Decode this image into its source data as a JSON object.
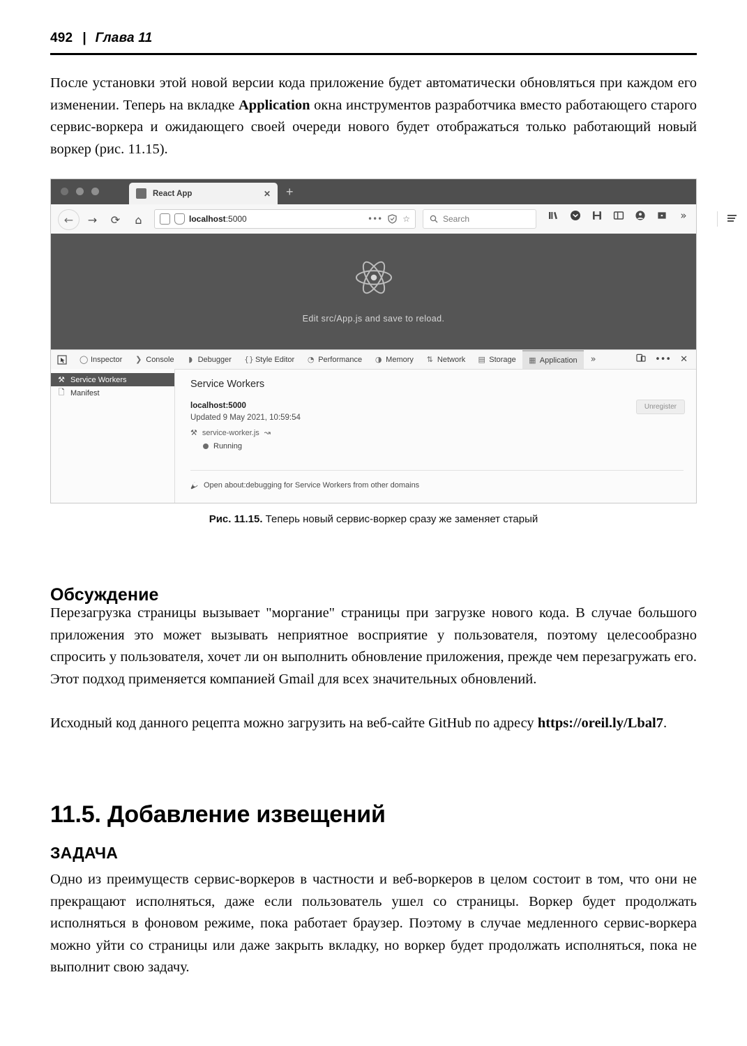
{
  "running_head": {
    "folio": "492",
    "separator": "|",
    "chapter": "Глава 11"
  },
  "intro_paragraph": {
    "before_bold": "После установки этой новой версии кода приложение будет автоматически обновляться при каждом его изменении. Теперь на вкладке ",
    "bold": "Application",
    "after_bold": " окна инструментов разработчика вместо работающего старого сервис-воркера и ожидающего своей очереди нового будет отображаться только работающий новый воркер (рис. 11.15)."
  },
  "figure": {
    "browser": {
      "tab_title": "React App",
      "tab_close": "✕",
      "new_tab": "+",
      "nav": {
        "back": "←",
        "forward": "→",
        "reload": "⟳",
        "home": "⌂"
      },
      "url": {
        "host": "localhost",
        "port": ":5000",
        "overflow": "•••",
        "shield": "shield-icon",
        "bookmark": "☆"
      },
      "search_placeholder": "Search",
      "toolbar_icons": [
        "library-icon",
        "pocket-icon",
        "save-to-pocket-icon",
        "sidebar-icon",
        "account-icon",
        "extension-icon",
        "overflow-icon"
      ],
      "overflow": "»",
      "menu": "hamburger-menu-icon"
    },
    "react_page": {
      "caption": "Edit src/App.js and save to reload."
    },
    "devtools": {
      "tabs": [
        {
          "label": "Inspector",
          "glyph": "◯",
          "selected": false
        },
        {
          "label": "Console",
          "glyph": "❯",
          "selected": false
        },
        {
          "label": "Debugger",
          "glyph": "◗",
          "selected": false
        },
        {
          "label": "Style Editor",
          "glyph": "{}",
          "selected": false
        },
        {
          "label": "Performance",
          "glyph": "◔",
          "selected": false
        },
        {
          "label": "Memory",
          "glyph": "◑",
          "selected": false
        },
        {
          "label": "Network",
          "glyph": "⇅",
          "selected": false
        },
        {
          "label": "Storage",
          "glyph": "▤",
          "selected": false
        },
        {
          "label": "Application",
          "glyph": "▦",
          "selected": true
        }
      ],
      "tabs_overflow": "»",
      "bar_right": {
        "responsive": "responsive-design-mode-icon",
        "meatball": "•••",
        "close": "✕"
      },
      "sidebar": [
        {
          "label": "Service Workers",
          "glyph": "⚒",
          "selected": true
        },
        {
          "label": "Manifest",
          "glyph": "🗋",
          "selected": false
        }
      ],
      "panel": {
        "heading": "Service Workers",
        "scope": "localhost:5000",
        "updated": "Updated 9 May 2021, 10:59:54",
        "worker_file": "service-worker.js",
        "worker_link_glyph": "↝",
        "status": "Running",
        "unregister_label": "Unregister",
        "footer_link": "Open about:debugging for Service Workers from other domains",
        "footer_glyph": "🔧"
      }
    },
    "caption_prefix": "Рис. 11.15.",
    "caption_text": " Теперь новый сервис-воркер сразу же заменяет старый"
  },
  "discussion": {
    "heading": "Обсуждение",
    "paragraph1": "Перезагрузка страницы вызывает \"моргание\" страницы при загрузке нового кода. В случае большого приложения это может вызывать неприятное восприятие у пользователя, поэтому целесообразно спросить у пользователя, хочет ли он выполнить обновление приложения, прежде чем перезагружать его. Этот подход применяется компанией Gmail для всех значительных обновлений.",
    "paragraph2_before": "Исходный код данного рецепта можно загрузить на веб-сайте GitHub по адресу ",
    "paragraph2_link": "https://oreil.ly/Lbal7",
    "paragraph2_after": "."
  },
  "section": {
    "heading": "11.5. Добавление извещений",
    "subheading": "ЗАДАЧА",
    "paragraph": "Одно из преимуществ сервис-воркеров в частности и веб-воркеров в целом состоит в том, что они не прекращают исполняться, даже если пользователь ушел со страницы. Воркер будет продолжать исполняться в фоновом режиме, пока работает браузер. Поэтому в случае медленного сервис-воркера можно уйти со страницы или даже закрыть вкладку, но воркер будет продолжать исполняться, пока не выполнит свою задачу."
  },
  "colors": {
    "react_bg": "#555555",
    "titlebar_bg": "#4f4f4f",
    "selected_sidebar_bg": "#555555",
    "selected_tab_bg": "#e3e3e3"
  }
}
